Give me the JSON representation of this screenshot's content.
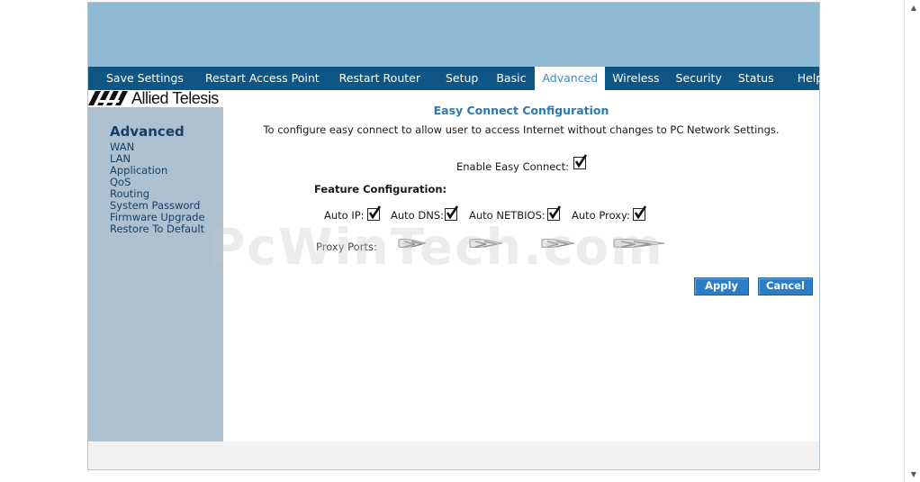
{
  "nav": {
    "items": [
      {
        "label": "Save Settings"
      },
      {
        "label": "Restart Access Point"
      },
      {
        "label": "Restart Router"
      },
      {
        "label": "Setup"
      },
      {
        "label": "Basic"
      },
      {
        "label": "Advanced"
      },
      {
        "label": "Wireless"
      },
      {
        "label": "Security"
      },
      {
        "label": "Status"
      },
      {
        "label": "Help"
      }
    ],
    "active": "Advanced"
  },
  "logo": {
    "text": "Allied Telesis"
  },
  "sidebar": {
    "title": "Advanced",
    "items": [
      {
        "label": "WAN"
      },
      {
        "label": "LAN"
      },
      {
        "label": "Application"
      },
      {
        "label": "QoS"
      },
      {
        "label": "Routing"
      },
      {
        "label": "System Password"
      },
      {
        "label": "Firmware Upgrade"
      },
      {
        "label": "Restore To Default"
      }
    ]
  },
  "content": {
    "heading": "Easy Connect Configuration",
    "subtitle": "To configure easy connect to allow user to access Internet without changes to PC Network Settings.",
    "enable_label": "Enable Easy Connect:",
    "enable_checked": true,
    "feature_title": "Feature Configuration:",
    "features": [
      {
        "label": "Auto IP:",
        "checked": true
      },
      {
        "label": "Auto DNS:",
        "checked": true
      },
      {
        "label": "Auto NETBIOS:",
        "checked": true
      },
      {
        "label": "Auto Proxy:",
        "checked": true
      }
    ],
    "proxy_ports_label": "Proxy Ports:",
    "apply_label": "Apply",
    "cancel_label": "Cancel"
  },
  "watermark": "PcWinTech.com",
  "colors": {
    "banner": "#8ebad3",
    "nav": "#0f5684",
    "sidebar": "#adc1d1",
    "heading": "#2f78b0",
    "button": "#2c7cc6"
  }
}
